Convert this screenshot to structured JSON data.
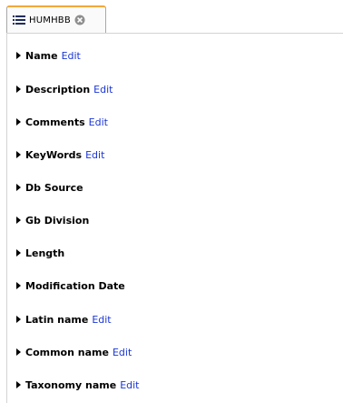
{
  "tab": {
    "label": "HUMHBB",
    "icon": "list-icon",
    "close_icon": "close-icon",
    "accent_color": "#f3a83a"
  },
  "edit_label": "Edit",
  "link_color": "#1a35d6",
  "fields": [
    {
      "label": "Name",
      "editable": true
    },
    {
      "label": "Description",
      "editable": true
    },
    {
      "label": "Comments",
      "editable": true
    },
    {
      "label": "KeyWords",
      "editable": true
    },
    {
      "label": "Db Source",
      "editable": false
    },
    {
      "label": "Gb Division",
      "editable": false
    },
    {
      "label": "Length",
      "editable": false
    },
    {
      "label": "Modification Date",
      "editable": false
    },
    {
      "label": "Latin name",
      "editable": true
    },
    {
      "label": "Common name",
      "editable": true
    },
    {
      "label": "Taxonomy name",
      "editable": true
    }
  ]
}
